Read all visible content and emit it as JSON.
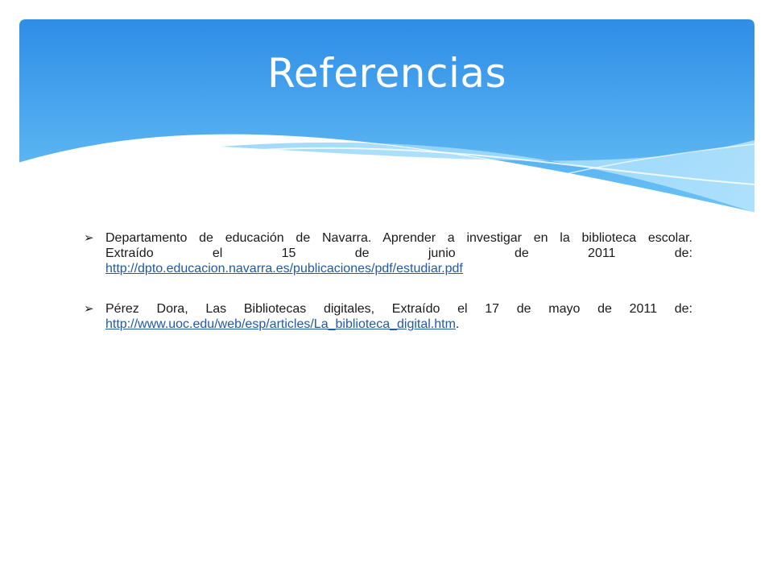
{
  "slide": {
    "title": "Referencias"
  },
  "colors": {
    "banner_top": "#2f8fe6",
    "banner_bottom": "#6cc4f5",
    "wave_light": "#9ad8fb",
    "link": "#1e5aa8"
  },
  "references": [
    {
      "icon": "arrow-bullet-icon",
      "line1": "Departamento de educación de Navarra. Aprender a investigar en la biblioteca escolar.",
      "line2": "Extraído el 15 de junio de 2011 de:",
      "url": "http://dpto.educacion.navarra.es/publicaciones/pdf/estudiar.pdf",
      "suffix": ""
    },
    {
      "icon": "arrow-bullet-icon",
      "line1": "Pérez Dora, Las Bibliotecas digitales, Extraído el  17 de mayo de 2011 de:",
      "line2": "",
      "url": "http://www.uoc.edu/web/esp/articles/La_biblioteca_digital.htm",
      "suffix": "."
    }
  ]
}
